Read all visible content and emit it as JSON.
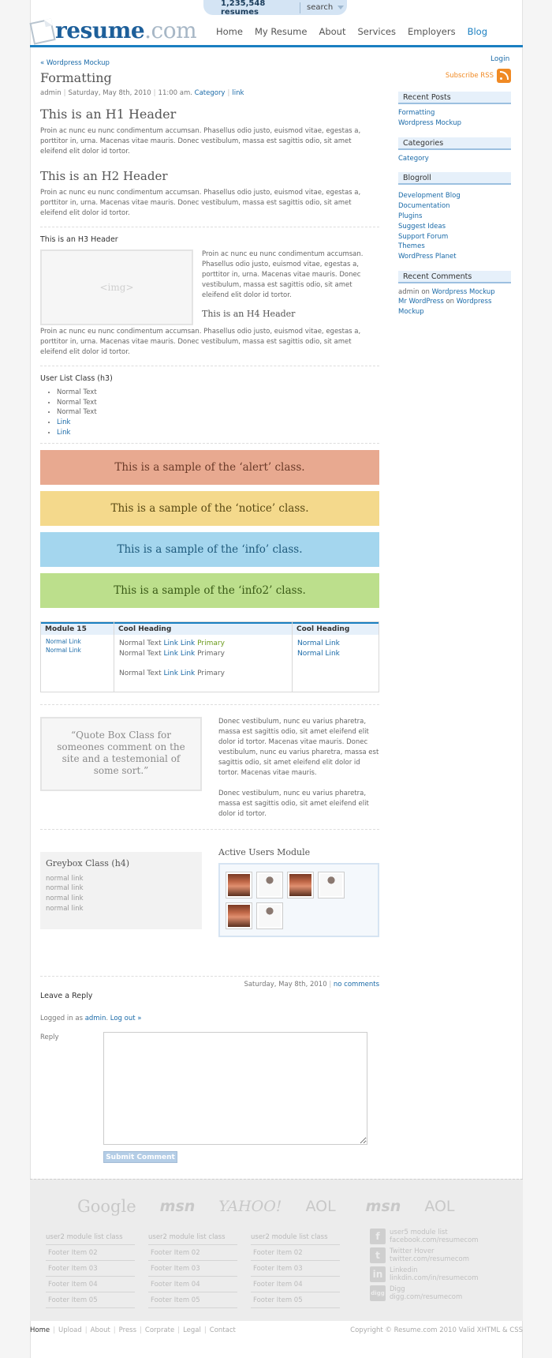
{
  "topbar": {
    "resume_count": "1,235,548 resumes",
    "search_label": "search"
  },
  "logo": {
    "part1": "resume",
    "part2": ".com"
  },
  "nav": [
    {
      "label": "Home",
      "active": false
    },
    {
      "label": "My Resume",
      "active": false
    },
    {
      "label": "About",
      "active": false
    },
    {
      "label": "Services",
      "active": false
    },
    {
      "label": "Employers",
      "active": false
    },
    {
      "label": "Blog",
      "active": true
    }
  ],
  "login": "Login",
  "post": {
    "breadcrumb": "« Wordpress Mockup",
    "title": "Formatting",
    "author": "admin",
    "date": "Saturday, May 8th, 2010",
    "time": "11:00 am.",
    "category": "Category",
    "link": "link",
    "h1": "This is an H1 Header",
    "p1": "Proin ac nunc eu nunc condimentum accumsan. Phasellus odio justo, euismod vitae, egestas a, porttitor in, urna. Macenas vitae mauris. Donec vestibulum, massa est sagittis odio, sit amet eleifend elit dolor id tortor.",
    "h2": "This is an H2 Header",
    "p2": "Proin ac nunc eu nunc condimentum accumsan. Phasellus odio justo, euismod vitae, egestas a, porttitor in, urna. Macenas vitae mauris. Donec vestibulum, massa est sagittis odio, sit amet eleifend elit dolor id tortor.",
    "h3": "This is an H3 Header",
    "img_label": "<img>",
    "img_text": "Proin ac nunc eu nunc condimentum accumsan. Phasellus odio justo, euismod vitae, egestas a, porttitor in, urna. Macenas vitae mauris. Donec vestibulum, massa est sagittis odio, sit amet eleifend elit dolor id tortor.",
    "h4": "This is an H4 Header",
    "p3": "Proin ac nunc eu nunc condimentum accumsan. Phasellus odio justo, euismod vitae, egestas a, porttitor in, urna. Macenas vitae mauris. Donec vestibulum, massa est sagittis odio, sit amet eleifend elit dolor id tortor.",
    "list_title": "User List Class (h3)",
    "list": [
      "Normal Text",
      "Normal Text",
      "Normal Text",
      "Link",
      "Link"
    ],
    "alert": "This is a sample of the ‘alert’ class.",
    "notice": "This is a sample of the ‘notice’ class.",
    "info": "This is a sample of the ‘info’ class.",
    "info2": "This is a sample of the ‘info2’ class.",
    "colors": {
      "alert_bg": "#e8a990",
      "alert_text": "#6a3a28",
      "notice_bg": "#f4d98c",
      "notice_text": "#5a4a14",
      "info_bg": "#a4d6ee",
      "info_text": "#1e5a7c",
      "info2_bg": "#bcdf8c",
      "info2_text": "#3a5a16"
    },
    "table": {
      "col1": {
        "head": "Module 15",
        "links": [
          "Normal Link",
          "Normal Link"
        ]
      },
      "col2": {
        "head": "Cool Heading",
        "rows": [
          {
            "text": "Normal Text",
            "l1": "Link",
            "l2": "Link",
            "p": "Primary"
          },
          {
            "text": "Normal Text",
            "l1": "Link",
            "l2": "Link",
            "p": "Primary"
          },
          {
            "text": "Normal Text",
            "l1": "Link",
            "l2": "Link",
            "p": "Primary"
          }
        ]
      },
      "col3": {
        "head": "Cool Heading",
        "links": [
          "Normal Link",
          "Normal Link"
        ]
      }
    },
    "quote": "“Quote Box Class for someones comment on the site and a testemonial of some sort.”",
    "quote_text1": "Donec vestibulum, nunc eu varius pharetra, massa est sagittis odio, sit amet eleifend elit dolor id tortor. Macenas vitae mauris. Donec vestibulum, nunc eu varius pharetra, massa est sagittis odio, sit amet eleifend elit dolor id tortor. Macenas vitae mauris.",
    "quote_text2": "Donec vestibulum, nunc eu varius pharetra, massa est sagittis odio, sit amet eleifend elit dolor id tortor.",
    "greybox": {
      "title": "Greybox Class (h4)",
      "links": [
        "normal link",
        "normal link",
        "normal link",
        "normal link"
      ]
    },
    "active_users": {
      "title": "Active Users Module"
    },
    "reply": {
      "date": "Saturday, May 8th, 2010",
      "comments": "no comments",
      "title": "Leave a Reply",
      "logged_prefix": "Logged in as",
      "user": "admin",
      "logout": "Log out »",
      "label": "Reply",
      "submit": "Submit Comment"
    }
  },
  "sidebar": {
    "rss": "Subscribe RSS",
    "recent_posts": {
      "title": "Recent Posts",
      "items": [
        "Formatting",
        "Wordpress Mockup"
      ]
    },
    "categories": {
      "title": "Categories",
      "items": [
        "Category"
      ]
    },
    "blogroll": {
      "title": "Blogroll",
      "items": [
        "Development Blog",
        "Documentation",
        "Plugins",
        "Suggest Ideas",
        "Support Forum",
        "Themes",
        "WordPress Planet"
      ]
    },
    "recent_comments": {
      "title": "Recent Comments",
      "c1_author": "admin",
      "c1_on": "on",
      "c1_post": "Wordpress Mockup",
      "c2_author": "Mr WordPress",
      "c2_on": "on",
      "c2_post": "Wordpress Mockup"
    }
  },
  "footer": {
    "logos": [
      "Google",
      "msn",
      "YAHOO!",
      "AOL",
      "msn",
      "AOL"
    ],
    "columns": [
      {
        "head": "user2 module list class",
        "items": [
          "Footer Item 02",
          "Footer Item 03",
          "Footer Item 04",
          "Footer Item 05"
        ]
      },
      {
        "head": "user2 module list class",
        "items": [
          "Footer Item 02",
          "Footer Item 03",
          "Footer Item 04",
          "Footer Item 05"
        ]
      },
      {
        "head": "user2 module list class",
        "items": [
          "Footer Item 02",
          "Footer Item 03",
          "Footer Item 04",
          "Footer Item 05"
        ]
      }
    ],
    "social": [
      {
        "icon": "f",
        "name": "user5 module list",
        "url": "facebook.com/resumecom"
      },
      {
        "icon": "t",
        "name": "Twitter Hover",
        "url": "twitter.com/resumecom"
      },
      {
        "icon": "in",
        "name": "Linkedin",
        "url": "linkdin.com/in/resumecom"
      },
      {
        "icon": "digg",
        "name": "Digg",
        "url": "digg.com/resumecom"
      }
    ],
    "bottom_links": [
      "Home",
      "Upload",
      "About",
      "Press",
      "Corprate",
      "Legal",
      "Contact"
    ],
    "copyright": "Copyright © Resume.com 2010 Valid XHTML & CSS"
  }
}
